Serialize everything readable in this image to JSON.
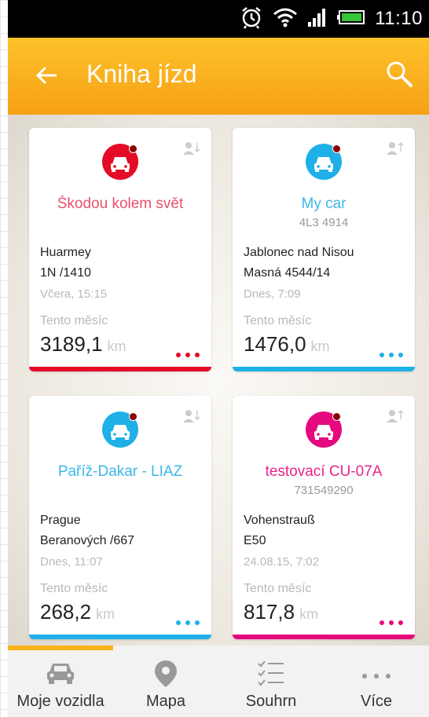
{
  "status_bar": {
    "time": "11:10",
    "icons": [
      "alarm-icon",
      "wifi-icon",
      "signal-icon",
      "battery-icon"
    ]
  },
  "app_bar": {
    "title": "Kniha jízd",
    "back_icon": "arrow-left-icon",
    "search_icon": "search-icon",
    "color": "#f9b21a"
  },
  "cards": [
    {
      "name": "Škodou kolem svět",
      "plate": "",
      "location_line1": "Huarmey",
      "location_line2": "1N /1410",
      "when": "Včera, 15:15",
      "month_label": "Tento měsíc",
      "distance": "3189,1",
      "unit": "km",
      "accent": "#e30b25",
      "share_icon": "person-down-icon"
    },
    {
      "name": "My car",
      "plate": "4L3 4914",
      "location_line1": "Jablonec nad Nisou",
      "location_line2": "Masná 4544/14",
      "when": "Dnes, 7:09",
      "month_label": "Tento měsíc",
      "distance": "1476,0",
      "unit": "km",
      "accent": "#1eb0e6",
      "share_icon": "person-up-icon"
    },
    {
      "name": "Paříž-Dakar - LIAZ",
      "plate": "",
      "location_line1": "Prague",
      "location_line2": "Beranových /667",
      "when": "Dnes, 11:07",
      "month_label": "Tento měsíc",
      "distance": "268,2",
      "unit": "km",
      "accent": "#1eb0e6",
      "share_icon": "person-down-icon"
    },
    {
      "name": "testovací CU-07A",
      "plate": "731549290",
      "location_line1": "Vohenstrauß",
      "location_line2": "E50",
      "when": "24.08.15, 7:02",
      "month_label": "Tento měsíc",
      "distance": "817,8",
      "unit": "km",
      "accent": "#e6087e",
      "share_icon": "person-up-icon"
    }
  ],
  "bottom_nav": {
    "active_index": 0,
    "items": [
      {
        "label": "Moje vozidla",
        "icon": "car-icon"
      },
      {
        "label": "Mapa",
        "icon": "map-pin-icon"
      },
      {
        "label": "Souhrn",
        "icon": "checklist-icon"
      },
      {
        "label": "Více",
        "icon": "more-dots-icon"
      }
    ]
  }
}
